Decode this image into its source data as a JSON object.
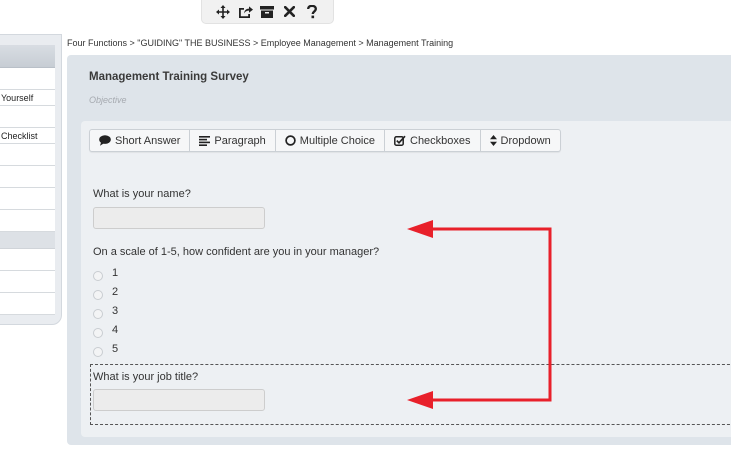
{
  "toolbar": {
    "icons": [
      "move-icon",
      "share-icon",
      "archive-icon",
      "close-icon",
      "help-icon"
    ]
  },
  "sidebar": {
    "items": [
      {
        "label": ""
      },
      {
        "label": "Yourself"
      },
      {
        "label": ""
      },
      {
        "label": "Checklist"
      },
      {
        "label": ""
      },
      {
        "label": ""
      },
      {
        "label": ""
      },
      {
        "label": ""
      },
      {
        "label": ""
      },
      {
        "label": ""
      },
      {
        "label": ""
      }
    ]
  },
  "breadcrumb": "Four Functions > \"GUIDING\" THE BUSINESS > Employee Management > Management Training",
  "survey": {
    "title": "Management Training Survey",
    "subtitle": "Objective"
  },
  "question_types": [
    {
      "label": "Short Answer",
      "icon": "comment-icon"
    },
    {
      "label": "Paragraph",
      "icon": "paragraph-icon"
    },
    {
      "label": "Multiple Choice",
      "icon": "circle-icon"
    },
    {
      "label": "Checkboxes",
      "icon": "checkbox-icon"
    },
    {
      "label": "Dropdown",
      "icon": "sort-icon"
    }
  ],
  "questions": [
    {
      "label": "What is your name?",
      "value": ""
    },
    {
      "label": "On a scale of 1-5, how confident are you in your manager?",
      "options": [
        "1",
        "2",
        "3",
        "4",
        "5"
      ]
    },
    {
      "label": "What is your job title?",
      "value": ""
    }
  ],
  "colors": {
    "annotation_arrow": "#e8202a"
  }
}
